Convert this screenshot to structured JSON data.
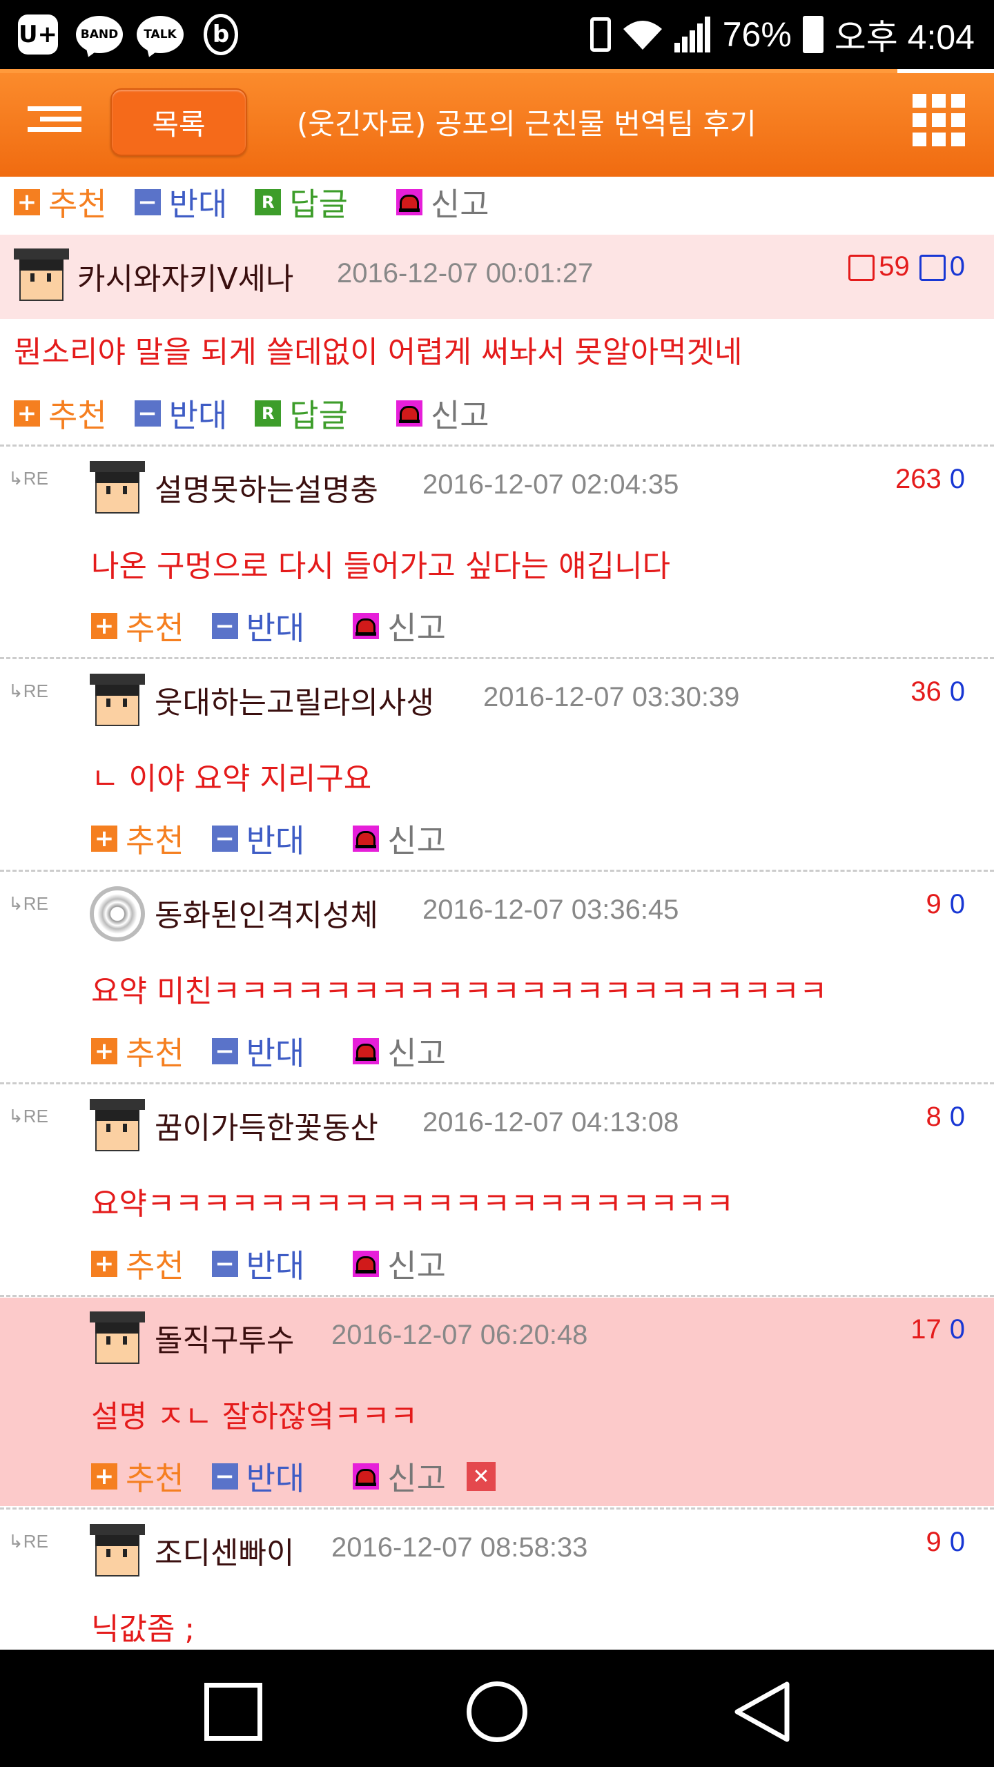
{
  "status_bar": {
    "apps": [
      "U+",
      "BAND",
      "TALK",
      "b"
    ],
    "battery": "76%",
    "time": "오후 4:04",
    "icons": [
      "vibrate-icon",
      "wifi-icon",
      "signal-icon",
      "battery-icon"
    ]
  },
  "header": {
    "list_button": "목록",
    "title": "(웃긴자료) 공포의 근친물 번역팀 후기"
  },
  "actions": {
    "recommend": "추천",
    "oppose": "반대",
    "reply": "답글",
    "report": "신고",
    "reply_icon_letter": "R",
    "re_label": "RE"
  },
  "comments": [
    {
      "nick": "카시와자키V세나",
      "date": "2016-12-07 00:01:27",
      "up": "59",
      "down": "0",
      "text": "뭔소리야 말을 되게 쓸데없이 어렵게 써놔서 못알아먹겟네",
      "is_reply": false
    },
    {
      "nick": "설명못하는설명충",
      "date": "2016-12-07 02:04:35",
      "up": "263",
      "down": "0",
      "text": "나온 구멍으로 다시 들어가고 싶다는 얘깁니다",
      "is_reply": true
    },
    {
      "nick": "웃대하는고릴라의사생",
      "date": "2016-12-07 03:30:39",
      "up": "36",
      "down": "0",
      "text": "ㄴ 이야 요약 지리구요",
      "is_reply": true
    },
    {
      "nick": "동화된인격지성체",
      "date": "2016-12-07 03:36:45",
      "up": "9",
      "down": "0",
      "text": "요약 미친ㅋㅋㅋㅋㅋㅋㅋㅋㅋㅋㅋㅋㅋㅋㅋㅋㅋㅋㅋㅋㅋㅋ",
      "is_reply": true
    },
    {
      "nick": "꿈이가득한꽃동산",
      "date": "2016-12-07 04:13:08",
      "up": "8",
      "down": "0",
      "text": "요약ㅋㅋㅋㅋㅋㅋㅋㅋㅋㅋㅋㅋㅋㅋㅋㅋㅋㅋㅋㅋㅋ",
      "is_reply": true
    },
    {
      "nick": "돌직구투수",
      "date": "2016-12-07 06:20:48",
      "up": "17",
      "down": "0",
      "text": "설명 ㅈㄴ 잘하잖엌ㅋㅋㅋ",
      "is_reply": false,
      "highlight": true
    },
    {
      "nick": "조디센빠이",
      "date": "2016-12-07 08:58:33",
      "up": "9",
      "down": "0",
      "text": "닉값좀 ;",
      "is_reply": true
    }
  ],
  "colors": {
    "header_orange": "#f57a20",
    "highlight_pink": "#fccaca",
    "head_pink": "#fde4e4",
    "text_red": "#e41b1b",
    "vote_blue": "#1837d4"
  }
}
